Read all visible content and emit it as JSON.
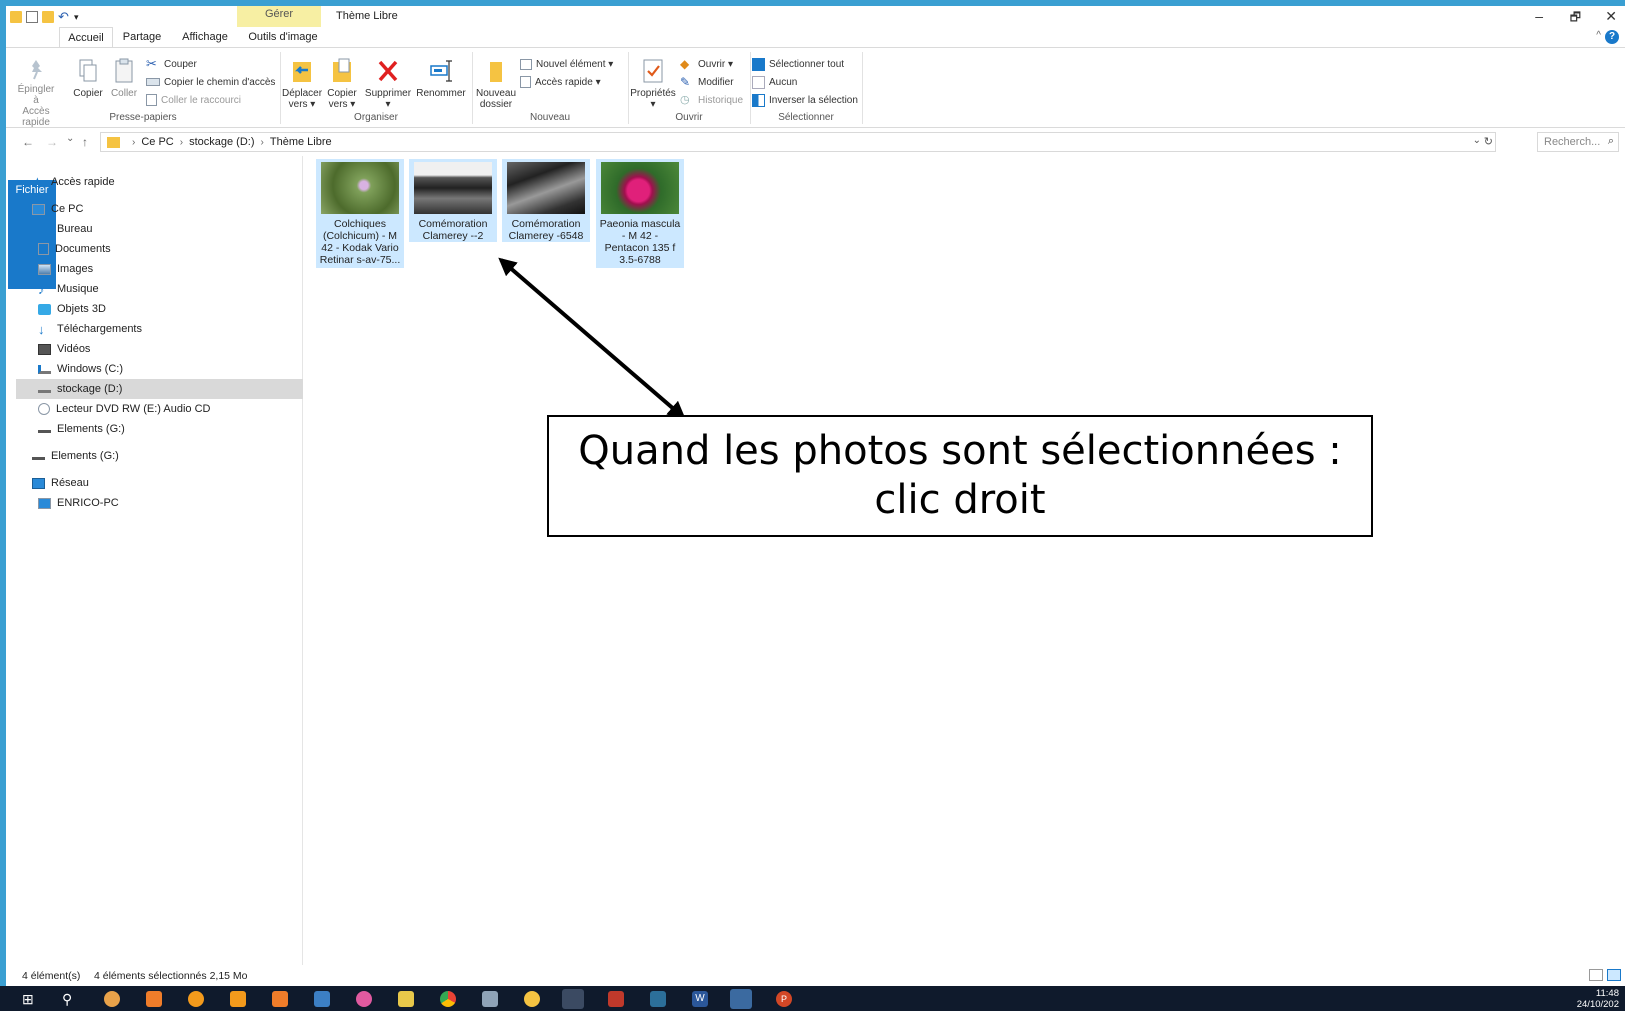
{
  "window": {
    "title": "Thème Libre",
    "context_group": "Gérer",
    "controls": {
      "minimize": "–",
      "restore": "🗗",
      "close": "✕"
    }
  },
  "tabs": [
    {
      "label": "Fichier"
    },
    {
      "label": "Accueil"
    },
    {
      "label": "Partage"
    },
    {
      "label": "Affichage"
    },
    {
      "label": "Outils d'image"
    }
  ],
  "help": "?",
  "ribbon": {
    "clipboard": {
      "group_label": "Presse-papiers",
      "pin_line1": "Épingler à",
      "pin_line2": "Accès rapide",
      "copy": "Copier",
      "paste": "Coller",
      "cut": "Couper",
      "copy_path": "Copier le chemin d'accès",
      "paste_shortcut": "Coller le raccourci"
    },
    "organize": {
      "group_label": "Organiser",
      "move_line1": "Déplacer",
      "move_line2": "vers ▾",
      "copyto_line1": "Copier",
      "copyto_line2": "vers ▾",
      "delete": "Supprimer",
      "delete_arrow": "▾",
      "rename": "Renommer"
    },
    "new": {
      "group_label": "Nouveau",
      "folder_line1": "Nouveau",
      "folder_line2": "dossier",
      "new_item": "Nouvel élément ▾",
      "easy_access": "Accès rapide ▾"
    },
    "open": {
      "group_label": "Ouvrir",
      "properties": "Propriétés",
      "properties_arrow": "▾",
      "open": "Ouvrir ▾",
      "edit": "Modifier",
      "history": "Historique"
    },
    "select": {
      "group_label": "Sélectionner",
      "select_all": "Sélectionner tout",
      "select_none": "Aucun",
      "invert": "Inverser la sélection"
    }
  },
  "nav": {
    "back": "←",
    "forward": "→",
    "recent": "⌄",
    "up": "↑",
    "crumbs": [
      "Ce PC",
      "stockage (D:)",
      "Thème Libre"
    ],
    "crumb_sep": "›",
    "search_placeholder": "Recherch...",
    "dropdown": "⌄",
    "refresh": "↻"
  },
  "sidebar": [
    {
      "label": "Accès rapide",
      "icon": "star-icon"
    },
    {
      "label": "Ce PC",
      "icon": "computer-icon"
    },
    {
      "label": "Bureau",
      "icon": "desktop-icon"
    },
    {
      "label": "Documents",
      "icon": "documents-icon"
    },
    {
      "label": "Images",
      "icon": "images-icon"
    },
    {
      "label": "Musique",
      "icon": "music-icon"
    },
    {
      "label": "Objets 3D",
      "icon": "objects3d-icon"
    },
    {
      "label": "Téléchargements",
      "icon": "download-icon"
    },
    {
      "label": "Vidéos",
      "icon": "videos-icon"
    },
    {
      "label": "Windows (C:)",
      "icon": "drive-icon"
    },
    {
      "label": "stockage (D:)",
      "icon": "drive-icon"
    },
    {
      "label": "Lecteur DVD RW (E:) Audio CD",
      "icon": "dvd-icon"
    },
    {
      "label": "Elements (G:)",
      "icon": "usb-drive-icon"
    },
    {
      "label": "Elements (G:)",
      "icon": "usb-drive-icon"
    },
    {
      "label": "Réseau",
      "icon": "network-icon"
    },
    {
      "label": "ENRICO-PC",
      "icon": "computer-icon"
    }
  ],
  "files": [
    {
      "name_lines": [
        "Colchiques",
        "(Colchicum) - M",
        "42 - Kodak Vario",
        "Retinar s-av-75..."
      ]
    },
    {
      "name_lines": [
        "Comémoration",
        "Clamerey --2"
      ]
    },
    {
      "name_lines": [
        "Comémoration",
        "Clamerey -6548"
      ]
    },
    {
      "name_lines": [
        "Paeonia mascula",
        "- M 42 -",
        "Pentacon 135 f",
        "3.5-6788"
      ]
    }
  ],
  "annotation": {
    "line1": "Quand les photos sont sélectionnées :",
    "line2": "clic droit"
  },
  "status": {
    "count": "4 élément(s)",
    "selection": "4 éléments sélectionnés  2,15 Mo"
  },
  "clock": {
    "time": "11:48",
    "date": "24/10/202"
  },
  "colors": {
    "accent": "#1979ca",
    "selection": "#cce8ff",
    "desktop": "#3a9fd2",
    "taskbar": "#0f1a2c"
  }
}
